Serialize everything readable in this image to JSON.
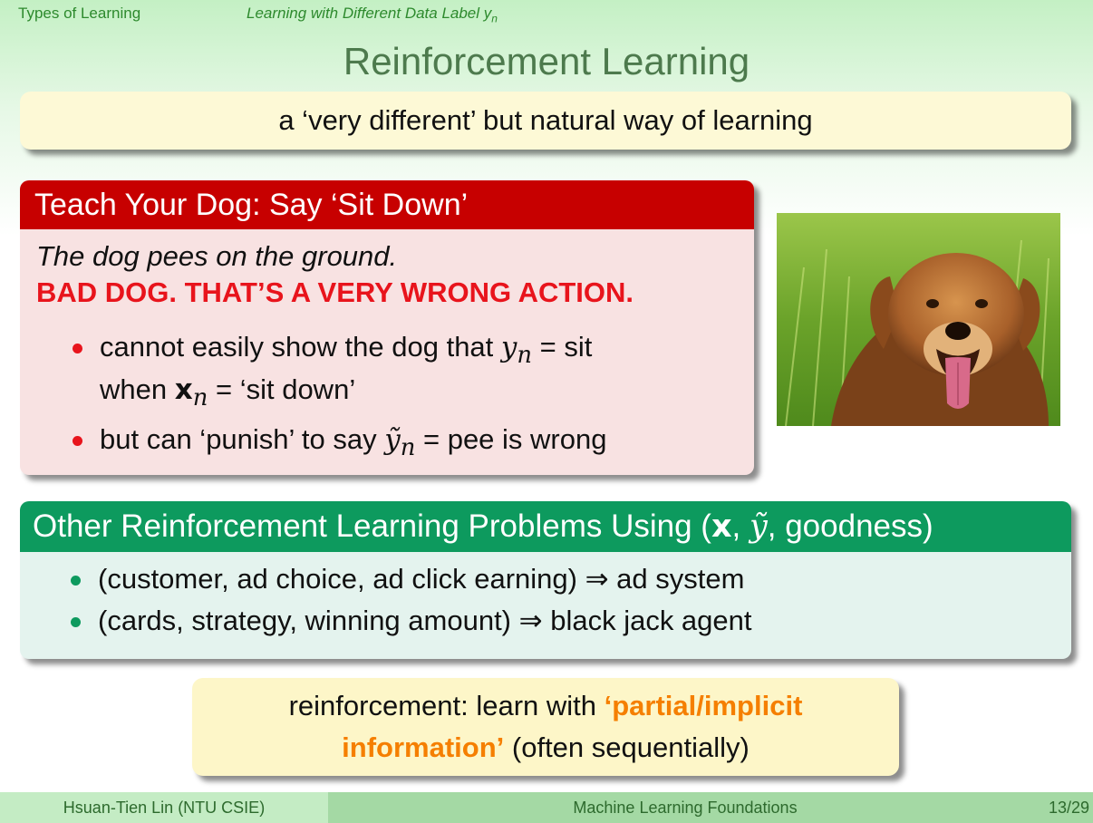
{
  "header": {
    "section": "Types of Learning",
    "subsection_prefix": "Learning with Different Data Label ",
    "subsection_var": "y",
    "subsection_sub": "n"
  },
  "title": "Reinforcement Learning",
  "tagline": "a ‘very different’ but natural way of learning",
  "dog_box": {
    "title": "Teach Your Dog: Say ‘Sit Down’",
    "line1": "The dog pees on the ground.",
    "line2": "BAD DOG. THAT’S A VERY WRONG ACTION.",
    "bullet1": {
      "a": "cannot easily show the dog that ",
      "y": "y",
      "sub": "n",
      "b": " = sit",
      "c": "when ",
      "x": "x",
      "xsub": "n",
      "d": " = ‘sit down’"
    },
    "bullet2": {
      "a": "but can ‘punish’ to say ",
      "y": "ỹ",
      "sub": "n",
      "b": " = pee is wrong"
    }
  },
  "other_box": {
    "title_prefix": "Other Reinforcement Learning Problems Using (",
    "title_x": "x",
    "title_sep1": ", ",
    "title_y": "ỹ",
    "title_rest": ", goodness)",
    "items": [
      "(customer, ad choice, ad click earning) ⇒ ad system",
      "(cards, strategy, winning amount) ⇒ black jack agent"
    ]
  },
  "note": {
    "a": "reinforcement: learn with ",
    "highlight1": "‘partial/implicit",
    "highlight2": "information’",
    "b": " (often sequentially)"
  },
  "footer": {
    "author": "Hsuan-Tien Lin  (NTU CSIE)",
    "course": "Machine Learning Foundations",
    "page": "13/29"
  },
  "colors": {
    "red_header": "#c70000",
    "green_header": "#0d9a5e",
    "highlight_orange": "#f57f00",
    "alert_red": "#e8141c"
  }
}
